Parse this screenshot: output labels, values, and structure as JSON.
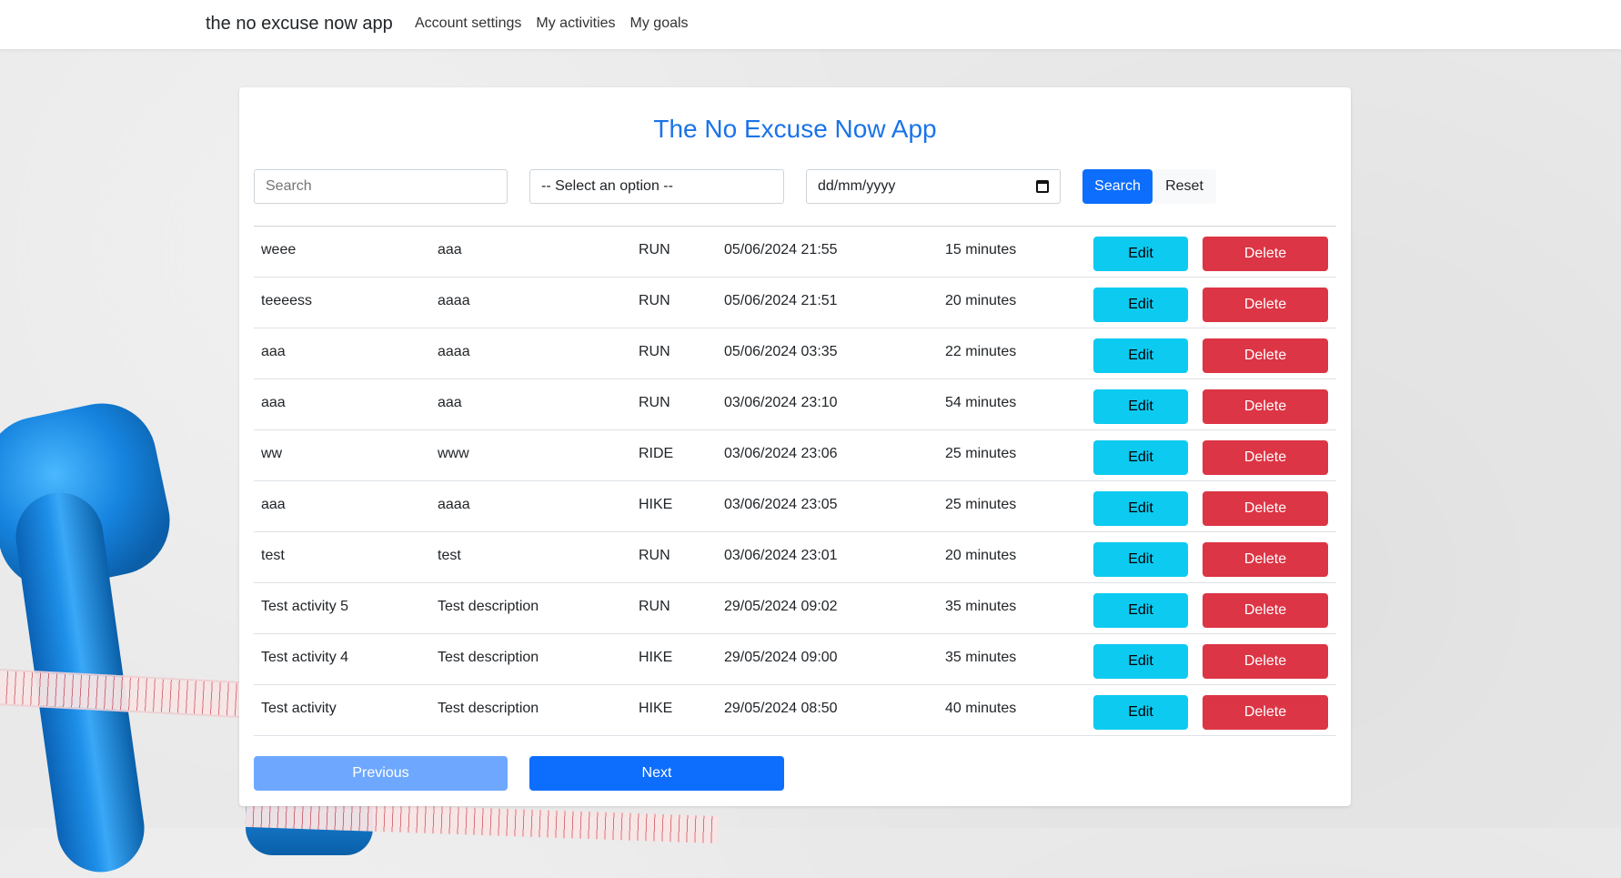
{
  "navbar": {
    "brand": "the no excuse now app",
    "links": [
      "Account settings",
      "My activities",
      "My goals"
    ]
  },
  "main": {
    "title": "The No Excuse Now App",
    "filters": {
      "search_placeholder": "Search",
      "select_value": "-- Select an option --",
      "date_value": "dd/mm/yyyy",
      "search_button": "Search",
      "reset_button": "Reset"
    },
    "rows": [
      {
        "name": "weee",
        "description": "aaa",
        "type": "RUN",
        "datetime": "05/06/2024 21:55",
        "duration": "15 minutes"
      },
      {
        "name": "teeeess",
        "description": "aaaa",
        "type": "RUN",
        "datetime": "05/06/2024 21:51",
        "duration": "20 minutes"
      },
      {
        "name": "aaa",
        "description": "aaaa",
        "type": "RUN",
        "datetime": "05/06/2024 03:35",
        "duration": "22 minutes"
      },
      {
        "name": "aaa",
        "description": "aaa",
        "type": "RUN",
        "datetime": "03/06/2024 23:10",
        "duration": "54 minutes"
      },
      {
        "name": "ww",
        "description": "www",
        "type": "RIDE",
        "datetime": "03/06/2024 23:06",
        "duration": "25 minutes"
      },
      {
        "name": "aaa",
        "description": "aaaa",
        "type": "HIKE",
        "datetime": "03/06/2024 23:05",
        "duration": "25 minutes"
      },
      {
        "name": "test",
        "description": "test",
        "type": "RUN",
        "datetime": "03/06/2024 23:01",
        "duration": "20 minutes"
      },
      {
        "name": "Test activity 5",
        "description": "Test description",
        "type": "RUN",
        "datetime": "29/05/2024 09:02",
        "duration": "35 minutes"
      },
      {
        "name": "Test activity 4",
        "description": "Test description",
        "type": "HIKE",
        "datetime": "29/05/2024 09:00",
        "duration": "35 minutes"
      },
      {
        "name": "Test activity",
        "description": "Test description",
        "type": "HIKE",
        "datetime": "29/05/2024 08:50",
        "duration": "40 minutes"
      }
    ],
    "row_actions": {
      "edit": "Edit",
      "delete": "Delete"
    },
    "pagination": {
      "previous": "Previous",
      "next": "Next"
    }
  },
  "colors": {
    "title": "#1a73e8",
    "primary": "#0d6efd",
    "primary_disabled": "#6ea8fe",
    "edit": "#0dcaf0",
    "delete": "#dc3545"
  },
  "icons": {
    "date_picker": "calendar-icon"
  }
}
